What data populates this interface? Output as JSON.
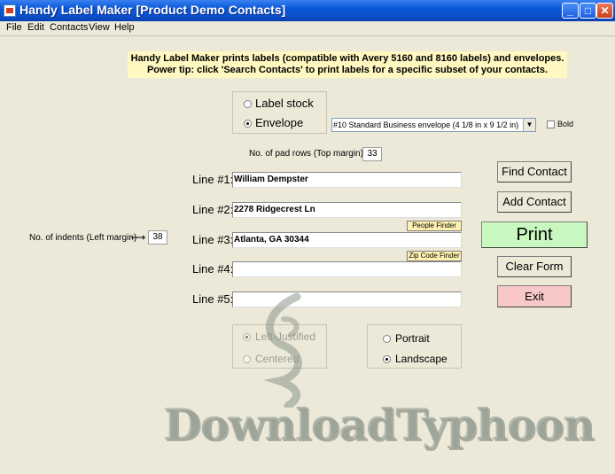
{
  "window": {
    "title": "Handy Label Maker  [Product Demo Contacts]",
    "controls": {
      "minimize": "_",
      "maximize": "□",
      "close": "✕"
    }
  },
  "menu": [
    "File",
    "Edit",
    "Contacts",
    "View",
    "Help"
  ],
  "info": {
    "line1": "Handy Label Maker prints labels (compatible with Avery 5160 and 8160 labels) and envelopes.",
    "line2": "Power tip: click 'Search Contacts' to print labels for a specific subset of your contacts."
  },
  "stock": {
    "options": [
      "Label stock",
      "Envelope"
    ],
    "selected": "Envelope",
    "envelope_size": "#10 Standard Business envelope (4 1/8 in x 9 1/2 in)",
    "bold_label": "Bold",
    "bold_checked": false
  },
  "pad_rows": {
    "label": "No. of pad rows (Top margin):",
    "value": "33"
  },
  "indents": {
    "label": "No. of indents (Left margin)",
    "arrow": "⟶",
    "value": "38"
  },
  "lines": [
    {
      "label": "Line #1:",
      "value": "William Dempster"
    },
    {
      "label": "Line #2:",
      "value": "2278 Ridgecrest Ln"
    },
    {
      "label": "Line #3:",
      "value": "Atlanta, GA  30344"
    },
    {
      "label": "Line #4:",
      "value": ""
    },
    {
      "label": "Line #5:",
      "value": ""
    }
  ],
  "helpers": {
    "people_finder": "People Finder",
    "zip_finder": "Zip Code Finder"
  },
  "buttons": {
    "find_contact": "Find Contact",
    "add_contact": "Add Contact",
    "print": "Print",
    "clear_form": "Clear Form",
    "exit": "Exit"
  },
  "justify": {
    "options": [
      "Left-Justified",
      "Centered"
    ],
    "selected": "Left-Justified",
    "enabled": false
  },
  "orientation": {
    "options": [
      "Portrait",
      "Landscape"
    ],
    "selected": "Landscape"
  },
  "watermark": {
    "text": "DownloadTyphoon"
  },
  "colors": {
    "print_button": "#c8f8c0",
    "exit_button": "#f8c8c8",
    "info_background": "#fff8c0",
    "title_bar": "#0a58d8"
  }
}
